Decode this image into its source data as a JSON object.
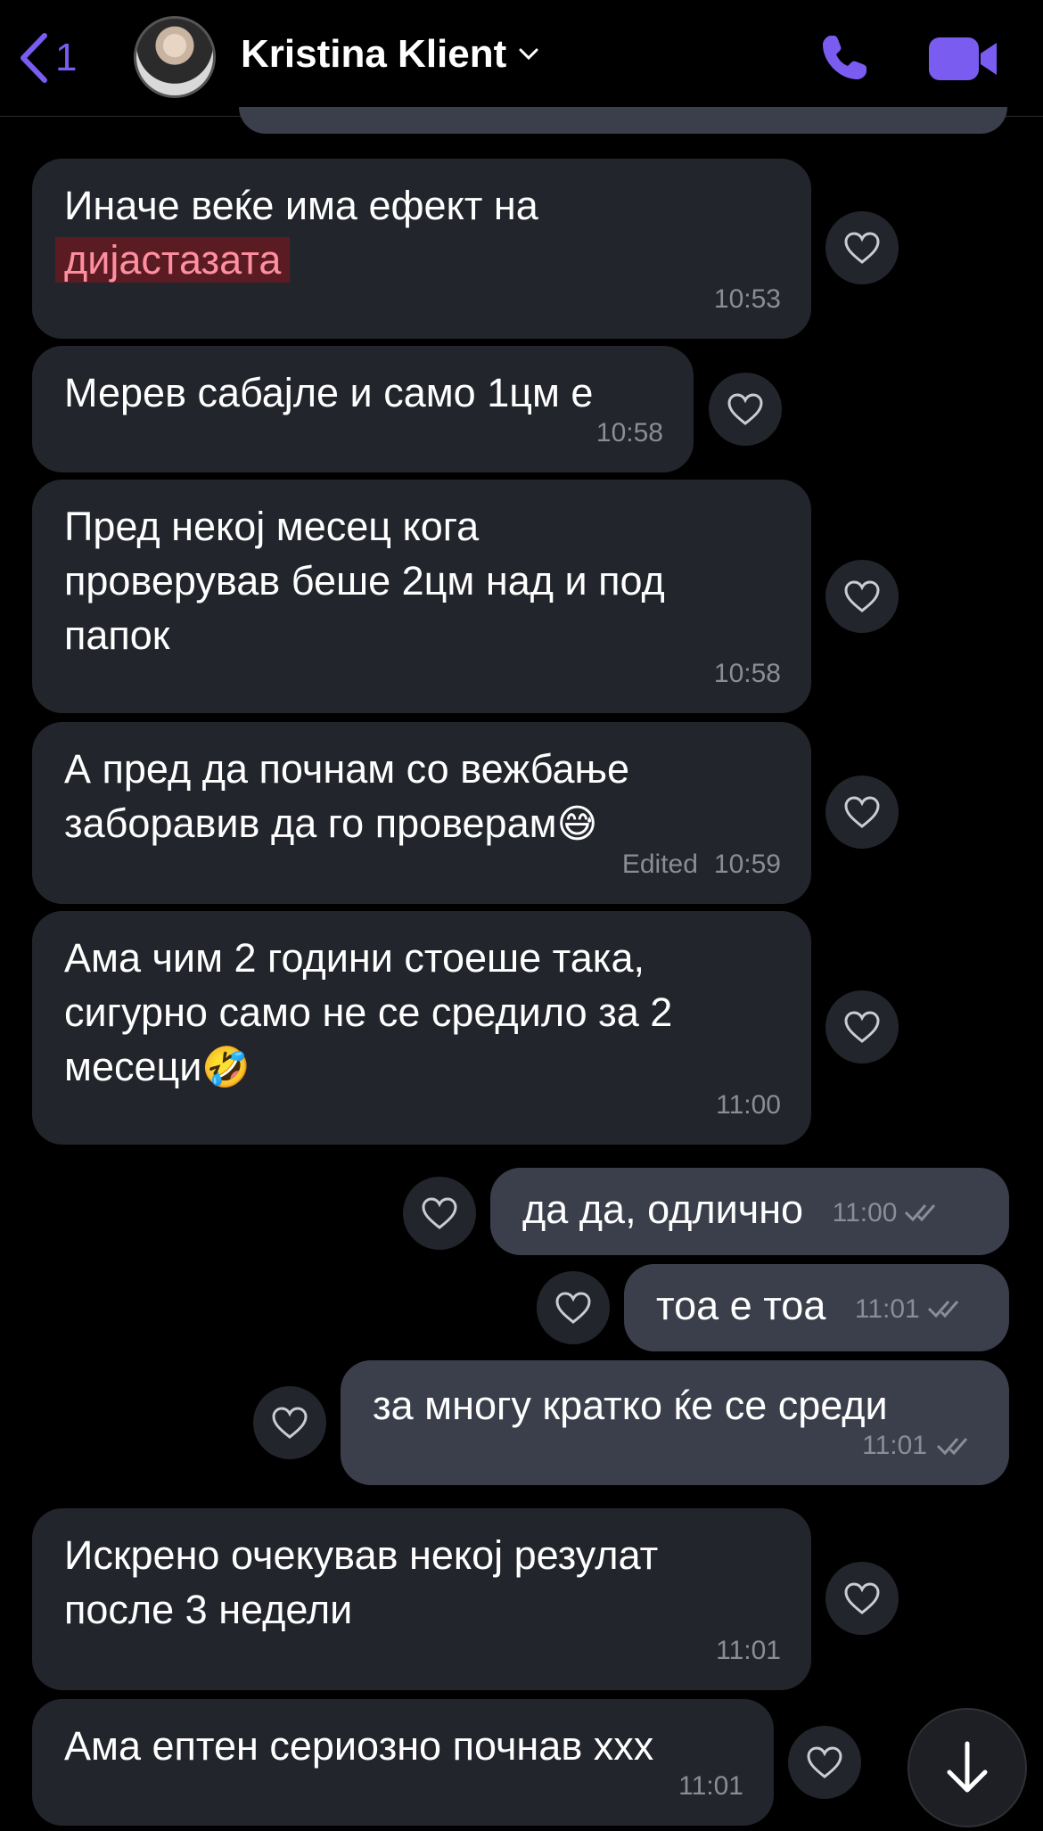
{
  "header": {
    "back_count": "1",
    "contact_name": "Kristina Klient",
    "icons": [
      "back-chevron-icon",
      "chevron-down-icon",
      "phone-icon",
      "video-icon"
    ]
  },
  "messages": [
    {
      "id": 1,
      "direction": "in",
      "text_before": "Иначе веќе има ефект на",
      "highlight": "дијастазата",
      "time": "10:53"
    },
    {
      "id": 2,
      "direction": "in",
      "text": "Мерев сабајле и само 1цм е",
      "time": "10:58"
    },
    {
      "id": 3,
      "direction": "in",
      "text": "Пред некој месец кога\nпроверував беше 2цм над и под\nпапок",
      "time": "10:58"
    },
    {
      "id": 4,
      "direction": "in",
      "text": "А пред да почнам со вежбање\nзаборавив да го проверам",
      "emoji": "😅",
      "edited_label": "Edited",
      "time": "10:59"
    },
    {
      "id": 5,
      "direction": "in",
      "text": "Ама чим 2 години стоеше така,\nсигурно само не се средило за 2\nмесеци",
      "emoji": "🤣",
      "time": "11:00"
    },
    {
      "id": 6,
      "direction": "out",
      "text": "да да, одлично",
      "time": "11:00"
    },
    {
      "id": 7,
      "direction": "out",
      "text": "тоа е тоа",
      "time": "11:01"
    },
    {
      "id": 8,
      "direction": "out",
      "text": "за многу кратко ќе се среди",
      "time": "11:01"
    },
    {
      "id": 9,
      "direction": "in",
      "text": "Искрено очекував некој резулат\nпосле 3 недели",
      "time": "11:01"
    },
    {
      "id": 10,
      "direction": "in",
      "text": "Ама ептен сериозно почнав ххх",
      "time": "11:01"
    }
  ],
  "colors": {
    "accent": "#7b5cf0",
    "incoming_bubble": "#23252c",
    "outgoing_bubble": "#3a3f4b",
    "highlight_bg": "#5a1c22",
    "highlight_text": "#ff8fa0"
  }
}
